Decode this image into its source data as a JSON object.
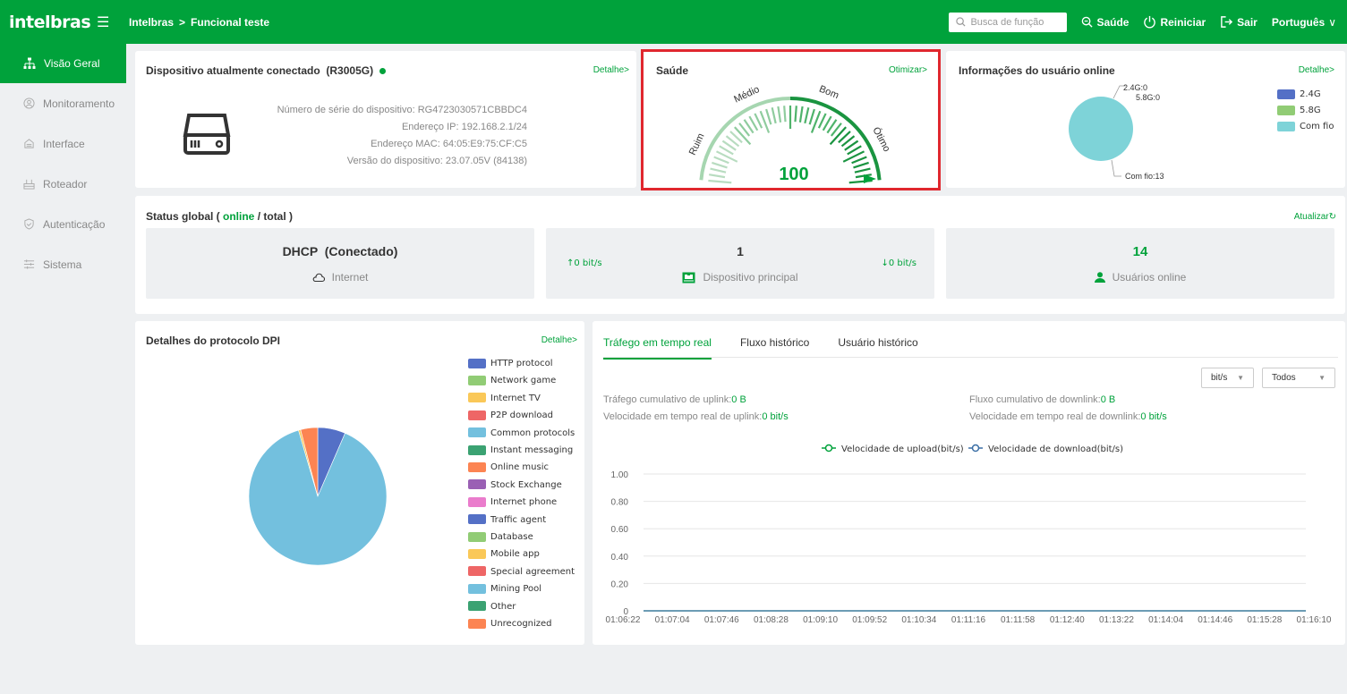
{
  "brand": {
    "logo": "intelbras",
    "accent": "#00a23b",
    "alert": "#e0272e"
  },
  "header": {
    "breadcrumb": [
      "Intelbras",
      ">",
      "Funcional teste"
    ],
    "search_placeholder": "Busca de função",
    "health": "Saúde",
    "restart": "Reiniciar",
    "logout": "Sair",
    "language": "Português"
  },
  "sidebar": {
    "items": [
      {
        "label": "Visão Geral",
        "icon": "network-icon",
        "active": true
      },
      {
        "label": "Monitoramento",
        "icon": "monitor-icon"
      },
      {
        "label": "Interface",
        "icon": "interface-icon"
      },
      {
        "label": "Roteador",
        "icon": "router-icon"
      },
      {
        "label": "Autenticação",
        "icon": "shield-icon"
      },
      {
        "label": "Sistema",
        "icon": "settings-icon"
      }
    ]
  },
  "device": {
    "title": "Dispositivo atualmente conectado",
    "model": "(R3005G)",
    "detail": "Detalhe>",
    "serial": "Número de série do dispositivo: RG4723030571CBBDC4",
    "ip": "Endereço IP: 192.168.2.1/24",
    "mac": "Endereço MAC: 64:05:E9:75:CF:C5",
    "version": "Versão do dispositivo: 23.07.05V (84138)"
  },
  "health": {
    "title": "Saúde",
    "optimize": "Otimizar>",
    "score": "100",
    "score_value": 100,
    "labels": [
      "Ruim",
      "Médio",
      "Bom",
      "Ótimo"
    ]
  },
  "users": {
    "title": "Informações do usuário online",
    "detail": "Detalhe>",
    "callouts": [
      "2.4G:0",
      "5.8G:0",
      "Com fio:13"
    ],
    "legend": [
      {
        "label": "2.4G",
        "color": "#5470c6"
      },
      {
        "label": "5.8G",
        "color": "#91cc75"
      },
      {
        "label": "Com fio",
        "color": "#7ed3d8"
      }
    ],
    "values": {
      "2.4G": 0,
      "5.8G": 0,
      "Com fio": 13
    }
  },
  "status": {
    "title_prefix": "Status global ( ",
    "online": "online",
    "title_suffix": " / total )",
    "refresh": "Atualizar",
    "wan": {
      "value": "DHCP  (Conectado)",
      "label": "Internet"
    },
    "up": "↑0 bit/s",
    "down": "↓0 bit/s",
    "device": {
      "value": "1",
      "label": "Dispositivo principal"
    },
    "users": {
      "value": "14",
      "label": "Usuários online"
    }
  },
  "dpi": {
    "title": "Detalhes do protocolo DPI",
    "detail": "Detalhe>",
    "legend": [
      {
        "label": "HTTP protocol",
        "color": "#5470c6"
      },
      {
        "label": "Network game",
        "color": "#91cc75"
      },
      {
        "label": "Internet TV",
        "color": "#fac858"
      },
      {
        "label": "P2P download",
        "color": "#ee6666"
      },
      {
        "label": "Common protocols",
        "color": "#73c0de"
      },
      {
        "label": "Instant messaging",
        "color": "#3ba272"
      },
      {
        "label": "Online music",
        "color": "#fc8452"
      },
      {
        "label": "Stock Exchange",
        "color": "#9a60b4"
      },
      {
        "label": "Internet phone",
        "color": "#ea7ccc"
      },
      {
        "label": "Traffic agent",
        "color": "#5470c6"
      },
      {
        "label": "Database",
        "color": "#91cc75"
      },
      {
        "label": "Mobile app",
        "color": "#fac858"
      },
      {
        "label": "Special agreement",
        "color": "#ee6666"
      },
      {
        "label": "Mining Pool",
        "color": "#73c0de"
      },
      {
        "label": "Other",
        "color": "#3ba272"
      },
      {
        "label": "Unrecognized",
        "color": "#fc8452"
      }
    ]
  },
  "traffic": {
    "tabs": [
      "Tráfego em tempo real",
      "Fluxo histórico",
      "Usuário histórico"
    ],
    "unit_select": "bit/s",
    "filter_select": "Todos",
    "uplink_total_label": "Tráfego cumulativo de uplink:",
    "uplink_total": "0 B",
    "downlink_total_label": "Fluxo cumulativo de downlink:",
    "downlink_total": "0 B",
    "uplink_speed_label": "Velocidade em tempo real de uplink:",
    "uplink_speed": "0 bit/s",
    "downlink_speed_label": "Velocidade em tempo real de downlink:",
    "downlink_speed": "0 bit/s",
    "legend_up": "Velocidade de upload(bit/s)",
    "legend_down": "Velocidade de download(bit/s)"
  },
  "chart_data": [
    {
      "type": "pie",
      "title": "Detalhes do protocolo DPI",
      "slices": [
        {
          "name": "HTTP protocol",
          "value": 6.5
        },
        {
          "name": "Common protocols",
          "value": 89.0
        },
        {
          "name": "Internet TV",
          "value": 0.5
        },
        {
          "name": "Unrecognized",
          "value": 4.0
        }
      ]
    },
    {
      "type": "pie",
      "title": "Informações do usuário online",
      "slices": [
        {
          "name": "2.4G",
          "value": 0
        },
        {
          "name": "5.8G",
          "value": 0
        },
        {
          "name": "Com fio",
          "value": 13
        }
      ]
    },
    {
      "type": "line",
      "x": [
        "01:06:22",
        "01:07:04",
        "01:07:46",
        "01:08:28",
        "01:09:10",
        "01:09:52",
        "01:10:34",
        "01:11:16",
        "01:11:58",
        "01:12:40",
        "01:13:22",
        "01:14:04",
        "01:14:46",
        "01:15:28",
        "01:16:10"
      ],
      "yticks": [
        "0",
        "0.20",
        "0.40",
        "0.60",
        "0.80",
        "1.00"
      ],
      "ylim": [
        0,
        1
      ],
      "series": [
        {
          "name": "Velocidade de upload(bit/s)",
          "color": "#00a23b",
          "values": [
            0,
            0,
            0,
            0,
            0,
            0,
            0,
            0,
            0,
            0,
            0,
            0,
            0,
            0,
            0
          ]
        },
        {
          "name": "Velocidade de download(bit/s)",
          "color": "#3a6ea5",
          "values": [
            0,
            0,
            0,
            0,
            0,
            0,
            0,
            0,
            0,
            0,
            0,
            0,
            0,
            0,
            0
          ]
        }
      ]
    }
  ]
}
